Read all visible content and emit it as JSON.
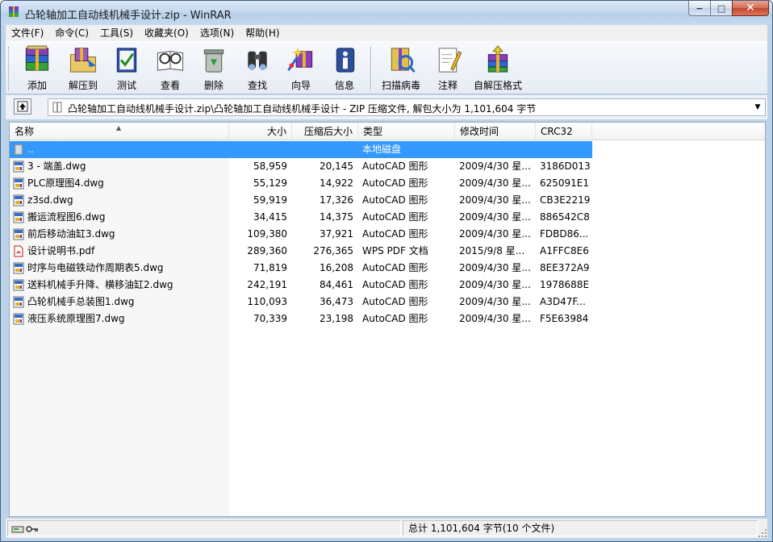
{
  "window": {
    "title": "凸轮轴加工自动线机械手设计.zip - WinRAR",
    "minimize_label": "−",
    "maximize_label": "□",
    "close_label": "✕"
  },
  "menu": [
    "文件(F)",
    "命令(C)",
    "工具(S)",
    "收藏夹(O)",
    "选项(N)",
    "帮助(H)"
  ],
  "toolbar": [
    {
      "label": "添加",
      "icon": "add-icon"
    },
    {
      "label": "解压到",
      "icon": "extract-icon"
    },
    {
      "label": "测试",
      "icon": "test-icon"
    },
    {
      "label": "查看",
      "icon": "view-icon"
    },
    {
      "label": "删除",
      "icon": "delete-icon"
    },
    {
      "label": "查找",
      "icon": "find-icon"
    },
    {
      "label": "向导",
      "icon": "wizard-icon"
    },
    {
      "label": "信息",
      "icon": "info-icon"
    },
    {
      "label": "扫描病毒",
      "icon": "virus-scan-icon"
    },
    {
      "label": "注释",
      "icon": "comment-icon"
    },
    {
      "label": "自解压格式",
      "icon": "sfx-icon"
    }
  ],
  "address": {
    "path": "凸轮轴加工自动线机械手设计.zip\\凸轮轴加工自动线机械手设计 - ZIP 压缩文件, 解包大小为 1,101,604 字节"
  },
  "columns": {
    "name": "名称",
    "size": "大小",
    "packed": "压缩后大小",
    "type": "类型",
    "modified": "修改时间",
    "crc": "CRC32"
  },
  "files": [
    {
      "name": "..",
      "size": "",
      "packed": "",
      "type": "本地磁盘",
      "modified": "",
      "crc": "",
      "icon": "folder-up-icon",
      "selected": true
    },
    {
      "name": "3 - 端盖.dwg",
      "size": "58,959",
      "packed": "20,145",
      "type": "AutoCAD 图形",
      "modified": "2009/4/30 星...",
      "crc": "3186D013",
      "icon": "dwg-file-icon"
    },
    {
      "name": "PLC原理图4.dwg",
      "size": "55,129",
      "packed": "14,922",
      "type": "AutoCAD 图形",
      "modified": "2009/4/30 星...",
      "crc": "625091E1",
      "icon": "dwg-file-icon"
    },
    {
      "name": "z3sd.dwg",
      "size": "59,919",
      "packed": "17,326",
      "type": "AutoCAD 图形",
      "modified": "2009/4/30 星...",
      "crc": "CB3E2219",
      "icon": "dwg-file-icon"
    },
    {
      "name": "搬运流程图6.dwg",
      "size": "34,415",
      "packed": "14,375",
      "type": "AutoCAD 图形",
      "modified": "2009/4/30 星...",
      "crc": "886542C8",
      "icon": "dwg-file-icon"
    },
    {
      "name": "前后移动油缸3.dwg",
      "size": "109,380",
      "packed": "37,921",
      "type": "AutoCAD 图形",
      "modified": "2009/4/30 星...",
      "crc": "FDBD86...",
      "icon": "dwg-file-icon"
    },
    {
      "name": "设计说明书.pdf",
      "size": "289,360",
      "packed": "276,365",
      "type": "WPS PDF 文档",
      "modified": "2015/9/8 星...",
      "crc": "A1FFC8E6",
      "icon": "pdf-file-icon"
    },
    {
      "name": "时序与电磁铁动作周期表5.dwg",
      "size": "71,819",
      "packed": "16,208",
      "type": "AutoCAD 图形",
      "modified": "2009/4/30 星...",
      "crc": "8EE372A9",
      "icon": "dwg-file-icon"
    },
    {
      "name": "送料机械手升降、横移油缸2.dwg",
      "size": "242,191",
      "packed": "84,461",
      "type": "AutoCAD 图形",
      "modified": "2009/4/30 星...",
      "crc": "1978688E",
      "icon": "dwg-file-icon"
    },
    {
      "name": "凸轮机械手总装图1.dwg",
      "size": "110,093",
      "packed": "36,473",
      "type": "AutoCAD 图形",
      "modified": "2009/4/30 星...",
      "crc": "A3D47F...",
      "icon": "dwg-file-icon"
    },
    {
      "name": "液压系统原理图7.dwg",
      "size": "70,339",
      "packed": "23,198",
      "type": "AutoCAD 图形",
      "modified": "2009/4/30 星...",
      "crc": "F5E63984",
      "icon": "dwg-file-icon"
    }
  ],
  "status": {
    "summary": "总计 1,101,604 字节(10 个文件)"
  },
  "colors": {
    "selection": "#3399ff",
    "title_bar": "#c3d7ee",
    "close_button": "#c4462c"
  }
}
